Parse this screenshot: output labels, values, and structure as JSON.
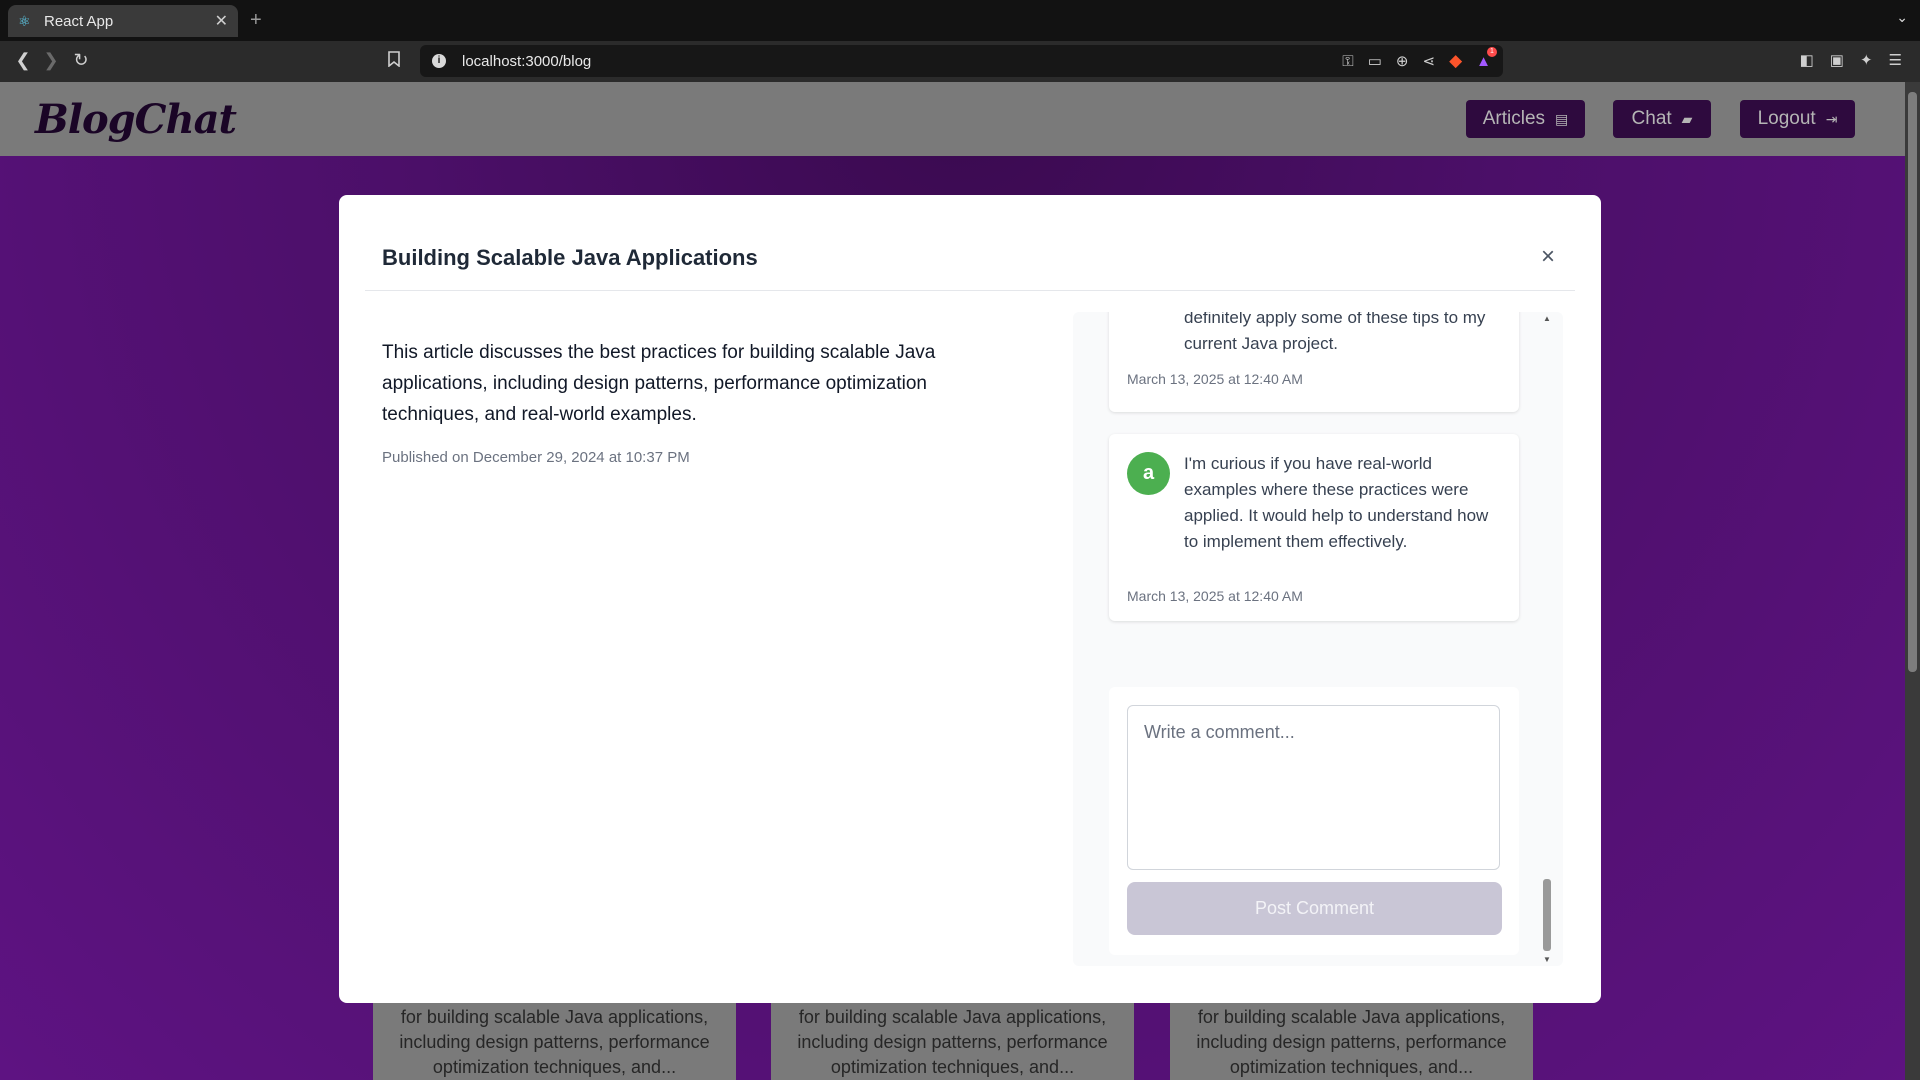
{
  "browser": {
    "tab_title": "React App",
    "new_tab_symbol": "+",
    "url": "localhost:3000/blog",
    "alert_count": "1"
  },
  "header": {
    "logo": "BlogChat",
    "nav": {
      "articles": "Articles",
      "chat": "Chat",
      "logout": "Logout"
    }
  },
  "modal": {
    "title": "Building Scalable Java Applications",
    "close_symbol": "×",
    "body": "This article discusses the best practices for building scalable Java applications, including design patterns, performance optimization techniques, and real-world examples.",
    "published": "Published on December 29, 2024 at 10:37 PM"
  },
  "comments": [
    {
      "text": "definitely apply some of these tips to my current Java project.",
      "time": "March 13, 2025 at 12:40 AM"
    },
    {
      "avatar": "a",
      "avatar_color": "#4caf50",
      "text": "I'm curious if you have real-world examples where these practices were applied. It would help to understand how to implement them effectively.",
      "time": "March 13, 2025 at 12:40 AM"
    }
  ],
  "comment_form": {
    "placeholder": "Write a comment...",
    "value": "",
    "submit_label": "Post Comment"
  },
  "background_cards": {
    "snippet": "for building scalable Java applications, including design patterns, performance optimization techniques, and..."
  },
  "colors": {
    "accent": "#2e0a3e",
    "background": "#5e1382",
    "post_button_disabled": "#c9c6d6"
  }
}
